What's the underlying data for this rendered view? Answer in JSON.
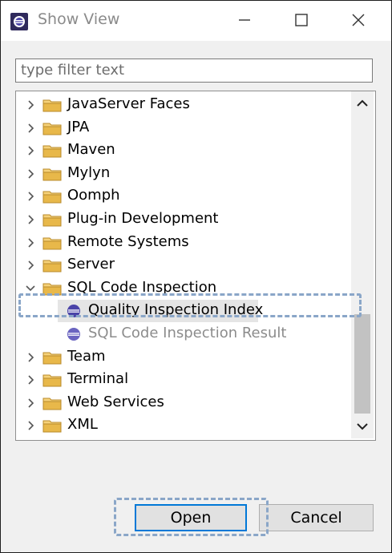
{
  "window": {
    "title": "Show View",
    "controls": [
      "minimize-icon",
      "maximize-icon",
      "close-icon"
    ]
  },
  "filter": {
    "placeholder": "type filter text",
    "value": ""
  },
  "tree": {
    "items": [
      {
        "label": "JavaServer Faces",
        "expanded": false
      },
      {
        "label": "JPA",
        "expanded": false
      },
      {
        "label": "Maven",
        "expanded": false
      },
      {
        "label": "Mylyn",
        "expanded": false
      },
      {
        "label": "Oomph",
        "expanded": false
      },
      {
        "label": "Plug-in Development",
        "expanded": false
      },
      {
        "label": "Remote Systems",
        "expanded": false
      },
      {
        "label": "Server",
        "expanded": false
      },
      {
        "label": "SQL Code Inspection",
        "expanded": true,
        "children": [
          {
            "label": "Quality Inspection Index",
            "selected": true
          },
          {
            "label": "SQL Code Inspection Result",
            "selected": false,
            "disabled": true
          }
        ]
      },
      {
        "label": "Team",
        "expanded": false
      },
      {
        "label": "Terminal",
        "expanded": false
      },
      {
        "label": "Web Services",
        "expanded": false
      },
      {
        "label": "XML",
        "expanded": false
      }
    ]
  },
  "buttons": {
    "open": "Open",
    "cancel": "Cancel"
  },
  "colors": {
    "folder": "#e8b84a",
    "view_icon": "#4b44a8",
    "highlight_dash": "#8aa6c8",
    "default_button_border": "#0078d7"
  }
}
